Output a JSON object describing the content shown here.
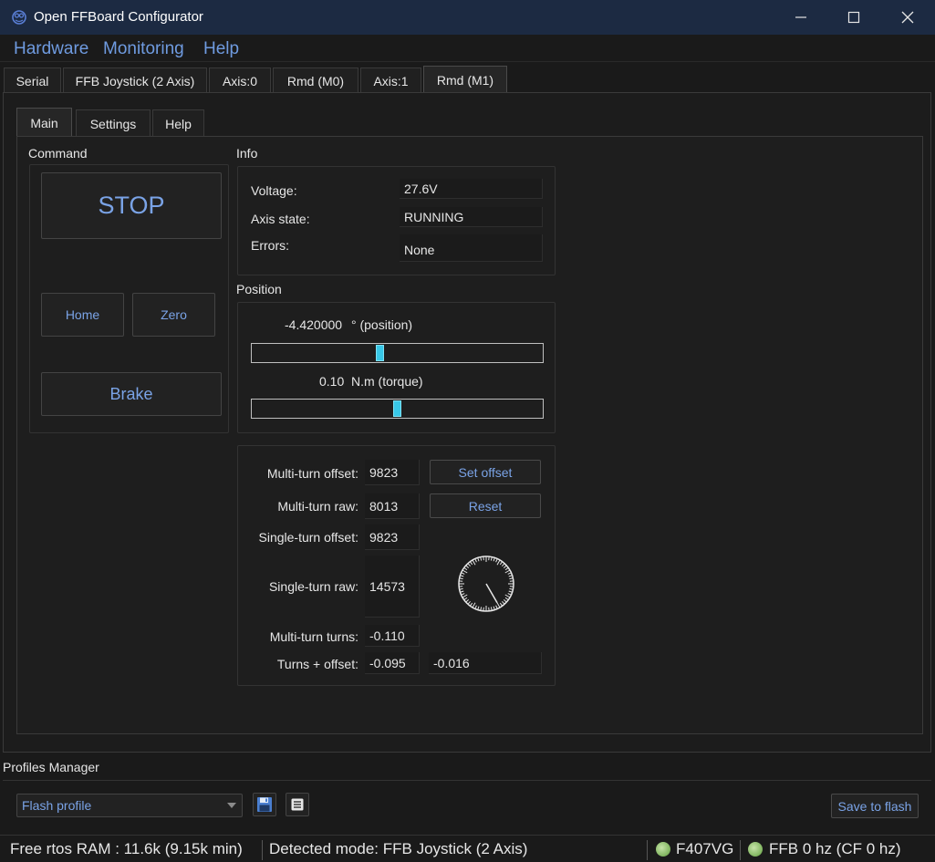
{
  "window": {
    "title": "Open FFBoard Configurator",
    "controls": [
      "minimize-icon",
      "maximize-icon",
      "close-icon"
    ]
  },
  "menu": {
    "items": [
      "Hardware",
      "Monitoring",
      "Help"
    ]
  },
  "tabs": [
    {
      "label": "Serial",
      "active": false
    },
    {
      "label": "FFB Joystick (2 Axis)",
      "active": false
    },
    {
      "label": "Axis:0",
      "active": false
    },
    {
      "label": "Rmd (M0)",
      "active": false
    },
    {
      "label": "Axis:1",
      "active": false
    },
    {
      "label": "Rmd (M1)",
      "active": true
    }
  ],
  "subtabs": [
    {
      "label": "Main",
      "active": true
    },
    {
      "label": "Settings",
      "active": false
    },
    {
      "label": "Help",
      "active": false
    }
  ],
  "command": {
    "title": "Command",
    "stop_label": "STOP",
    "home_label": "Home",
    "zero_label": "Zero",
    "brake_label": "Brake"
  },
  "info": {
    "title": "Info",
    "rows": [
      {
        "label": "Voltage:",
        "value": "27.6V"
      },
      {
        "label": "Axis state:",
        "value": "RUNNING"
      },
      {
        "label": "Errors:",
        "value": "None"
      }
    ]
  },
  "position": {
    "title": "Position",
    "position_value": "-4.420000",
    "position_unit": "° (position)",
    "position_slider_fraction": 0.44,
    "torque_value": "0.10",
    "torque_unit": "N.m (torque)",
    "torque_slider_fraction": 0.5
  },
  "multiturn": {
    "rows": [
      {
        "label": "Multi-turn offset:",
        "value": "9823"
      },
      {
        "label": "Multi-turn raw:",
        "value": "8013"
      },
      {
        "label": "Single-turn offset:",
        "value": "9823"
      },
      {
        "label": "Single-turn raw:",
        "value": "14573"
      },
      {
        "label": "Multi-turn turns:",
        "value": "-0.110"
      },
      {
        "label": "Turns + offset:",
        "value": "-0.095"
      }
    ],
    "extra_value": "-0.016",
    "set_offset_label": "Set offset",
    "reset_label": "Reset",
    "dial_angle_deg": 150
  },
  "profiles": {
    "title": "Profiles Manager",
    "selected": "Flash profile",
    "save_icon": "floppy-disk-icon",
    "list_icon": "document-list-icon",
    "save_to_flash_label": "Save to flash"
  },
  "status": {
    "ram": "Free rtos RAM : 11.6k (9.15k min)",
    "mode": "Detected mode: FFB Joystick (2 Axis)",
    "board": "F407VG",
    "ffb": "FFB 0 hz (CF 0 hz)"
  },
  "colors": {
    "accent": "#6f9be0",
    "titlebar": "#1c2a42",
    "slider_handle": "#38c8e8",
    "led": "#8fbf6a"
  }
}
